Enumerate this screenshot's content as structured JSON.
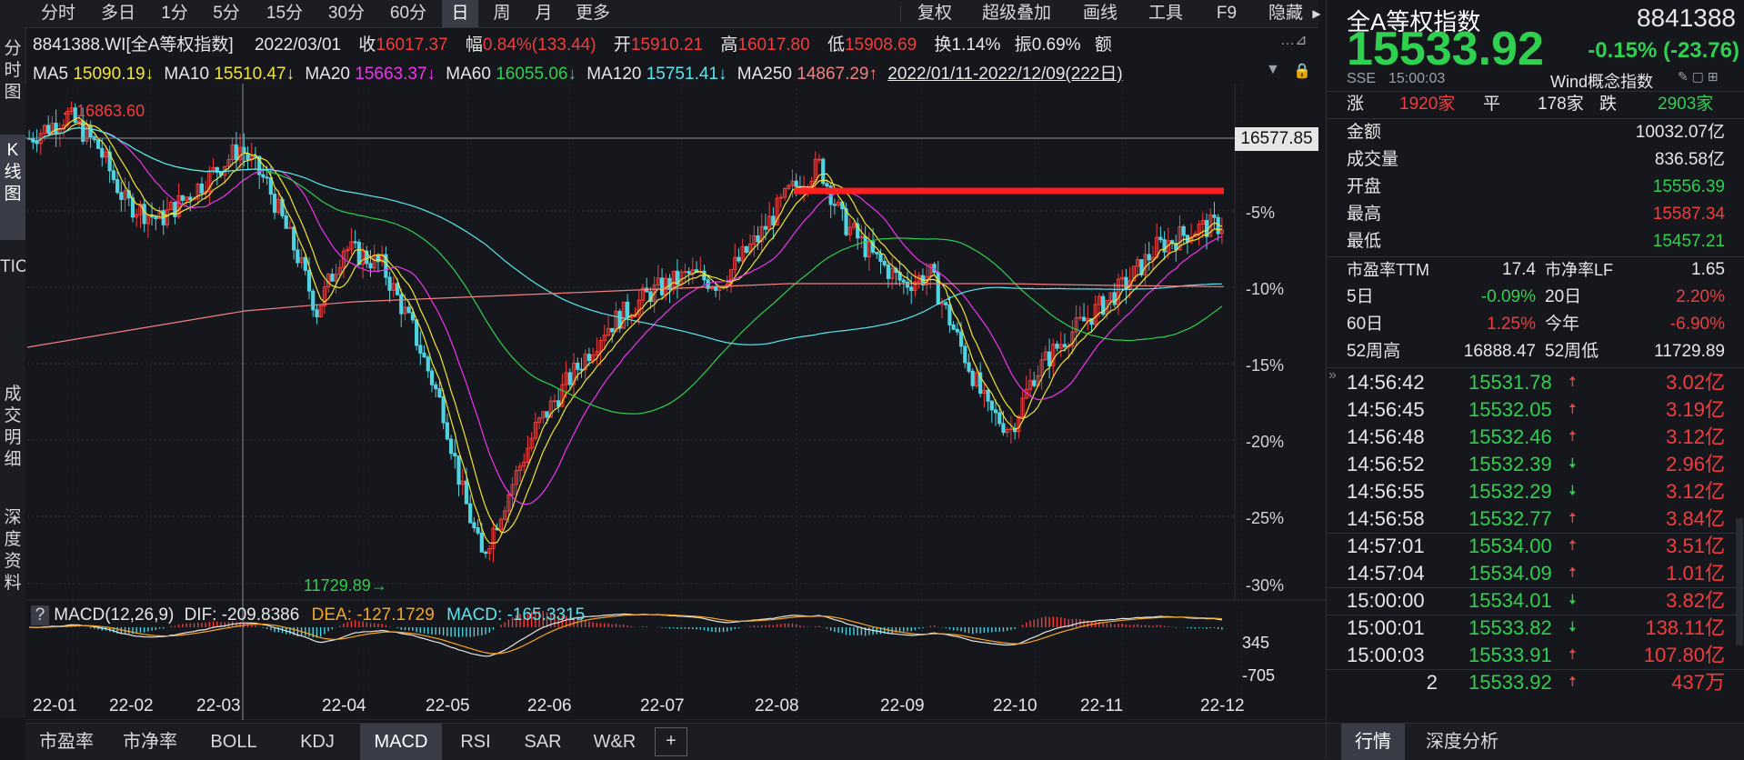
{
  "toolbar": {
    "left_items": [
      "分时",
      "多日",
      "1分",
      "5分",
      "15分",
      "30分",
      "60分",
      "日",
      "周",
      "月",
      "更多"
    ],
    "active_index": 7,
    "right_items": [
      "复权",
      "超级叠加",
      "画线",
      "工具",
      "F9",
      "隐藏"
    ]
  },
  "left_tabs": [
    "分时图",
    "K线图",
    "TICK",
    "成交明细",
    "深度资料"
  ],
  "left_tabs_active": 1,
  "info_bar": {
    "code": "8841388.WI[全A等权指数]",
    "date": "2022/03/01",
    "close_label": "收",
    "close": "16017.37",
    "change_label": "幅",
    "change": "0.84%(133.44)",
    "open_label": "开",
    "open": "15910.21",
    "high_label": "高",
    "high": "16017.80",
    "low_label": "低",
    "low": "15908.69",
    "turnover_label": "换",
    "turnover": "1.14%",
    "amplitude_label": "振",
    "amplitude": "0.69%",
    "amount_label": "额"
  },
  "ma_bar": {
    "items": [
      {
        "label": "MA5",
        "value": "15090.19↓",
        "color": "#f0e43a"
      },
      {
        "label": "MA10",
        "value": "15510.47↓",
        "color": "#f0e43a"
      },
      {
        "label": "MA20",
        "value": "15663.37↓",
        "color": "#ee35ee"
      },
      {
        "label": "MA60",
        "value": "16055.06↓",
        "color": "#2fcf4f"
      },
      {
        "label": "MA120",
        "value": "15751.41↓",
        "color": "#5be6f0"
      },
      {
        "label": "MA250",
        "value": "14867.29↑",
        "color": "#f08080"
      }
    ],
    "range": "2022/01/11-2022/12/09(222日)"
  },
  "chart": {
    "crosshair_value": "16577.85",
    "high_marker": "16863.60",
    "low_marker": "11729.89",
    "pct_labels": [
      "-5%",
      "-10%",
      "-15%",
      "-20%",
      "-25%",
      "-30%"
    ],
    "x_labels": [
      "22-01",
      "22-02",
      "22-03",
      "22-04",
      "22-05",
      "22-06",
      "22-07",
      "22-08",
      "22-09",
      "22-10",
      "22-11",
      "22-12"
    ],
    "macd_header": {
      "name": "MACD(12,26,9)",
      "dif": "DIF: -209.8386",
      "dea": "DEA: -127.1729",
      "macd": "MACD: -165.3315"
    },
    "macd_scale": [
      "345",
      "-705"
    ]
  },
  "chart_data": {
    "type": "line",
    "x_ticks": [
      "22-01",
      "22-02",
      "22-03",
      "22-04",
      "22-05",
      "22-06",
      "22-07",
      "22-08",
      "22-09",
      "22-10",
      "22-11",
      "22-12"
    ],
    "period_high": 16863.6,
    "period_low": 11729.89,
    "y_scale_pct": [
      "-5%",
      "-10%",
      "-15%",
      "-20%",
      "-25%",
      "-30%"
    ],
    "series": [
      {
        "name": "MA5",
        "values": [
          16500,
          16000,
          15900,
          14500,
          12600,
          13900,
          14900,
          15900,
          14900,
          13400,
          14700,
          15090
        ]
      },
      {
        "name": "MA10",
        "values": [
          16400,
          16050,
          15950,
          14700,
          12900,
          13800,
          14800,
          15800,
          15000,
          13600,
          14500,
          15510
        ]
      },
      {
        "name": "MA20",
        "values": [
          16300,
          16100,
          15900,
          15000,
          13300,
          13800,
          14700,
          15600,
          15100,
          13900,
          14400,
          15663
        ]
      },
      {
        "name": "MA60",
        "values": [
          16200,
          16300,
          16200,
          15800,
          14700,
          14200,
          14500,
          15100,
          15300,
          15000,
          14900,
          16055
        ]
      },
      {
        "name": "MA120",
        "values": [
          16000,
          15900,
          15700,
          15500,
          15200,
          15000,
          14900,
          14900,
          14950,
          15000,
          15100,
          15751
        ]
      },
      {
        "name": "MA250",
        "values": [
          14200,
          14400,
          14600,
          14700,
          14750,
          14800,
          14850,
          14900,
          14900,
          14900,
          14880,
          14867
        ]
      }
    ],
    "macd": {
      "dif": -209.8386,
      "dea": -127.1729,
      "macd": -165.3315,
      "scale_top": 345,
      "scale_bottom": -705
    }
  },
  "right": {
    "name": "全A等权指数",
    "code": "8841388",
    "price": "15533.92",
    "change": "-0.15% (-23.76)",
    "exchange": "SSE",
    "time": "15:00:03",
    "concept": "Wind概念指数",
    "rise_label": "涨",
    "rise": "1920家",
    "flat_label": "平",
    "flat": "178家",
    "fall_label": "跌",
    "fall": "2903家",
    "stats": [
      {
        "label": "金额",
        "value": "10032.07亿",
        "color": "#e6e6e6"
      },
      {
        "label": "成交量",
        "value": "836.58亿",
        "color": "#e6e6e6"
      },
      {
        "label": "开盘",
        "value": "15556.39",
        "color": "#2fcf4f"
      },
      {
        "label": "最高",
        "value": "15587.34",
        "color": "#f23c3c"
      },
      {
        "label": "最低",
        "value": "15457.21",
        "color": "#2fcf4f"
      }
    ],
    "pe_label": "市盈率TTM",
    "pe": "17.4",
    "pb_label": "市净率LF",
    "pb": "1.65",
    "perf": [
      {
        "l1": "5日",
        "v1": "-0.09%",
        "c1": "#2fcf4f",
        "l2": "20日",
        "v2": "2.20%",
        "c2": "#f23c3c"
      },
      {
        "l1": "60日",
        "v1": "1.25%",
        "c1": "#f23c3c",
        "l2": "今年",
        "v2": "-6.90%",
        "c2": "#f23c3c"
      },
      {
        "l1": "52周高",
        "v1": "16888.47",
        "c1": "#e6e6e6",
        "l2": "52周低",
        "v2": "11729.89",
        "c2": "#e6e6e6"
      }
    ],
    "ticks": [
      {
        "time": "14:56:42",
        "price": "15531.78",
        "dir": "up",
        "vol": "3.02亿"
      },
      {
        "time": "14:56:45",
        "price": "15532.05",
        "dir": "up",
        "vol": "3.19亿"
      },
      {
        "time": "14:56:48",
        "price": "15532.46",
        "dir": "up",
        "vol": "3.12亿"
      },
      {
        "time": "14:56:52",
        "price": "15532.39",
        "dir": "down",
        "vol": "2.96亿"
      },
      {
        "time": "14:56:55",
        "price": "15532.29",
        "dir": "down",
        "vol": "3.12亿"
      },
      {
        "time": "14:56:58",
        "price": "15532.77",
        "dir": "up",
        "vol": "3.84亿"
      },
      {
        "time": "14:57:01",
        "price": "15534.00",
        "dir": "up",
        "vol": "3.51亿"
      },
      {
        "time": "14:57:04",
        "price": "15534.09",
        "dir": "up",
        "vol": "1.01亿"
      },
      {
        "time": "15:00:00",
        "price": "15534.01",
        "dir": "down",
        "vol": "3.82亿"
      },
      {
        "time": "15:00:01",
        "price": "15533.82",
        "dir": "down",
        "vol": "138.11亿"
      },
      {
        "time": "15:00:03",
        "price": "15533.91",
        "dir": "up",
        "vol": "107.80亿"
      },
      {
        "time": "2",
        "price": "15533.92",
        "dir": "up",
        "vol": "437万"
      }
    ],
    "bottom_tabs": [
      "行情",
      "深度分析"
    ]
  },
  "bottom_tabs": [
    "市盈率",
    "市净率",
    "BOLL",
    "KDJ",
    "MACD",
    "RSI",
    "SAR",
    "W&R",
    "+"
  ],
  "bottom_tabs_active": 4,
  "colors": {
    "up": "#f23c3c",
    "down": "#2fcf4f",
    "bg": "#16171c",
    "trend_line": "#ff2020"
  }
}
